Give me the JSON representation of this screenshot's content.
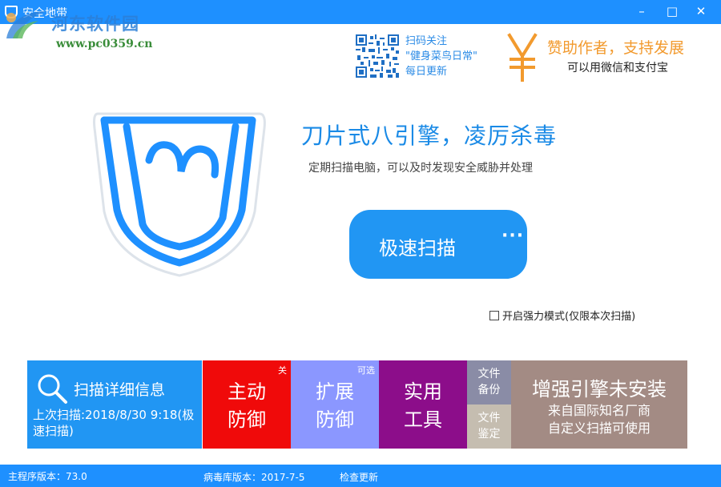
{
  "window": {
    "title": "安全地带",
    "minimize": "–",
    "restore": "□",
    "close": "✕"
  },
  "watermark": {
    "title": "河东软件园",
    "url": "www.pc0359.cn"
  },
  "promo": {
    "qr_line1": "扫码关注",
    "qr_line2": "\"健身菜鸟日常\"",
    "qr_line3": "每日更新",
    "yen_icon": "yen-icon",
    "sponsor_title": "赞助作者，支持发展",
    "sponsor_sub": "可以用微信和支付宝"
  },
  "hero": {
    "headline": "刀片式八引擎，凌厉杀毒",
    "subline": "定期扫描电脑，可以及时发现安全威胁并处理",
    "scan_button": "极速扫描",
    "scan_more": "···",
    "strong_mode": "开启强力模式(仅限本次扫描)"
  },
  "tiles": {
    "scan_info": {
      "title": "扫描详细信息",
      "last_scan": "上次扫描:2018/8/30 9:18(极速扫描)"
    },
    "active_defense": {
      "line1": "主动",
      "line2": "防御",
      "badge": "关"
    },
    "ext_defense": {
      "line1": "扩展",
      "line2": "防御",
      "badge": "可选"
    },
    "tools": {
      "line1": "实用",
      "line2": "工具"
    },
    "file_backup": {
      "line1": "文件",
      "line2": "备份"
    },
    "file_verify": {
      "line1": "文件",
      "line2": "鉴定"
    },
    "engine": {
      "title": "增强引擎未安装",
      "line1": "来自国际知名厂商",
      "line2": "自定义扫描可使用"
    }
  },
  "status": {
    "version": "主程序版本：73.0",
    "db_version": "病毒库版本：2017-7-5",
    "check_update": "检查更新"
  },
  "colors": {
    "primary": "#1e90ff",
    "scan_button": "#2196f3",
    "active_defense": "#f00a0a",
    "ext_defense": "#8b97ff",
    "tools": "#8c0d8a",
    "file_backup": "#8a8ca6",
    "file_verify": "#c5bdb0",
    "engine": "#a38b84",
    "sponsor": "#f29a2e"
  }
}
